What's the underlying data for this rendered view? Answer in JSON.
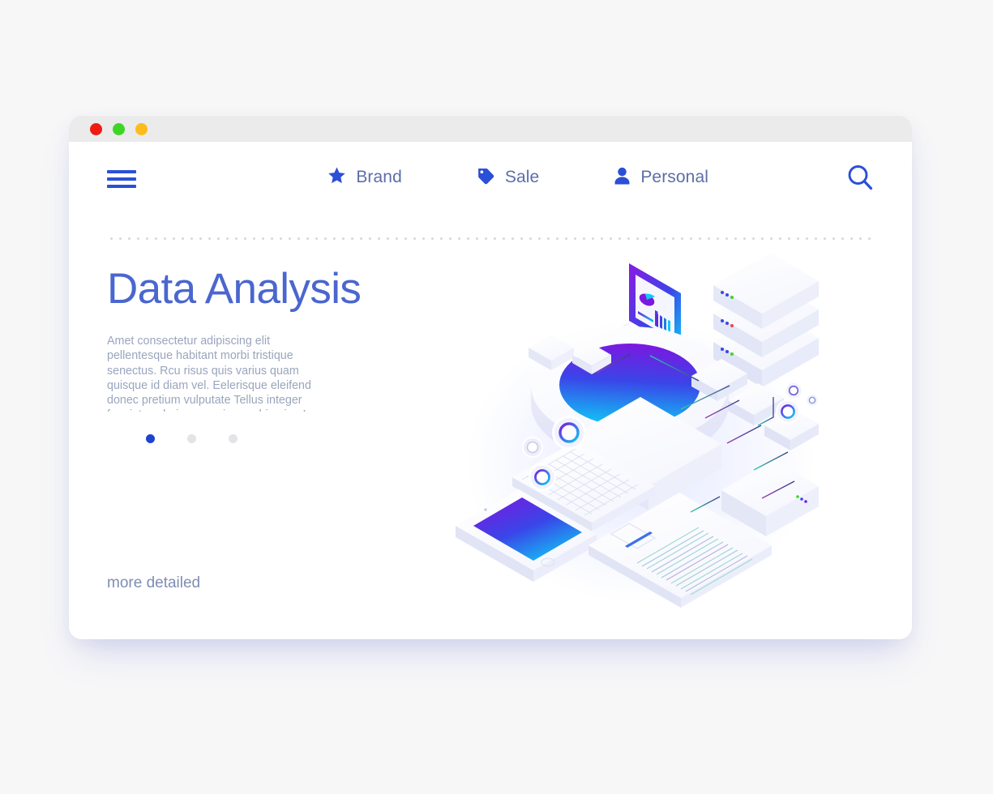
{
  "window": {
    "traffic_lights": [
      {
        "name": "close",
        "color": "#ee1c12"
      },
      {
        "name": "minimize",
        "color": "#3ed625"
      },
      {
        "name": "maximize",
        "color": "#fcbc1c"
      }
    ]
  },
  "nav": {
    "menu_icon": "hamburger-icon",
    "items": [
      {
        "icon": "star-icon",
        "label": "Brand"
      },
      {
        "icon": "tag-icon",
        "label": "Sale"
      },
      {
        "icon": "person-icon",
        "label": "Personal"
      }
    ],
    "search_icon": "search-icon"
  },
  "hero": {
    "title": "Data Analysis",
    "paragraph": "Amet consectetur adipiscing elit pellentesque habitant morbi tristique senectus. Rcu risus quis varius quam quisque id diam vel. Eelerisque eleifend donec pretium vulputate Tellus integer feugiat scelerisque varius mwbi enim. In aliquam sem fringilla ut. Enim ti.",
    "carousel": {
      "total": 3,
      "active_index": 0
    },
    "cta_label": "more detailed"
  },
  "colors": {
    "page_background": "#f7f7f8",
    "card_background": "#ffffff",
    "titlebar": "#ebebeb",
    "accent_blue": "#2b4fd6",
    "title_blue": "#4a66cf",
    "nav_text": "#5d6ea8",
    "body_text": "#9aa5bd",
    "link_text": "#7f8db4",
    "dot_active": "#1d43cf",
    "dot_inactive": "#e3e3e8",
    "gradient_start": "#7b18e0",
    "gradient_mid": "#3a45e8",
    "gradient_end": "#0fc9f5"
  },
  "illustration": {
    "name": "isometric-data-analysis-scene",
    "elements": [
      "laptop-with-charts",
      "central-gradient-disc",
      "server-stack",
      "cascading-boxes",
      "gear-wheels",
      "keyboard",
      "smartphone",
      "document-sheet",
      "connector-lines"
    ]
  }
}
